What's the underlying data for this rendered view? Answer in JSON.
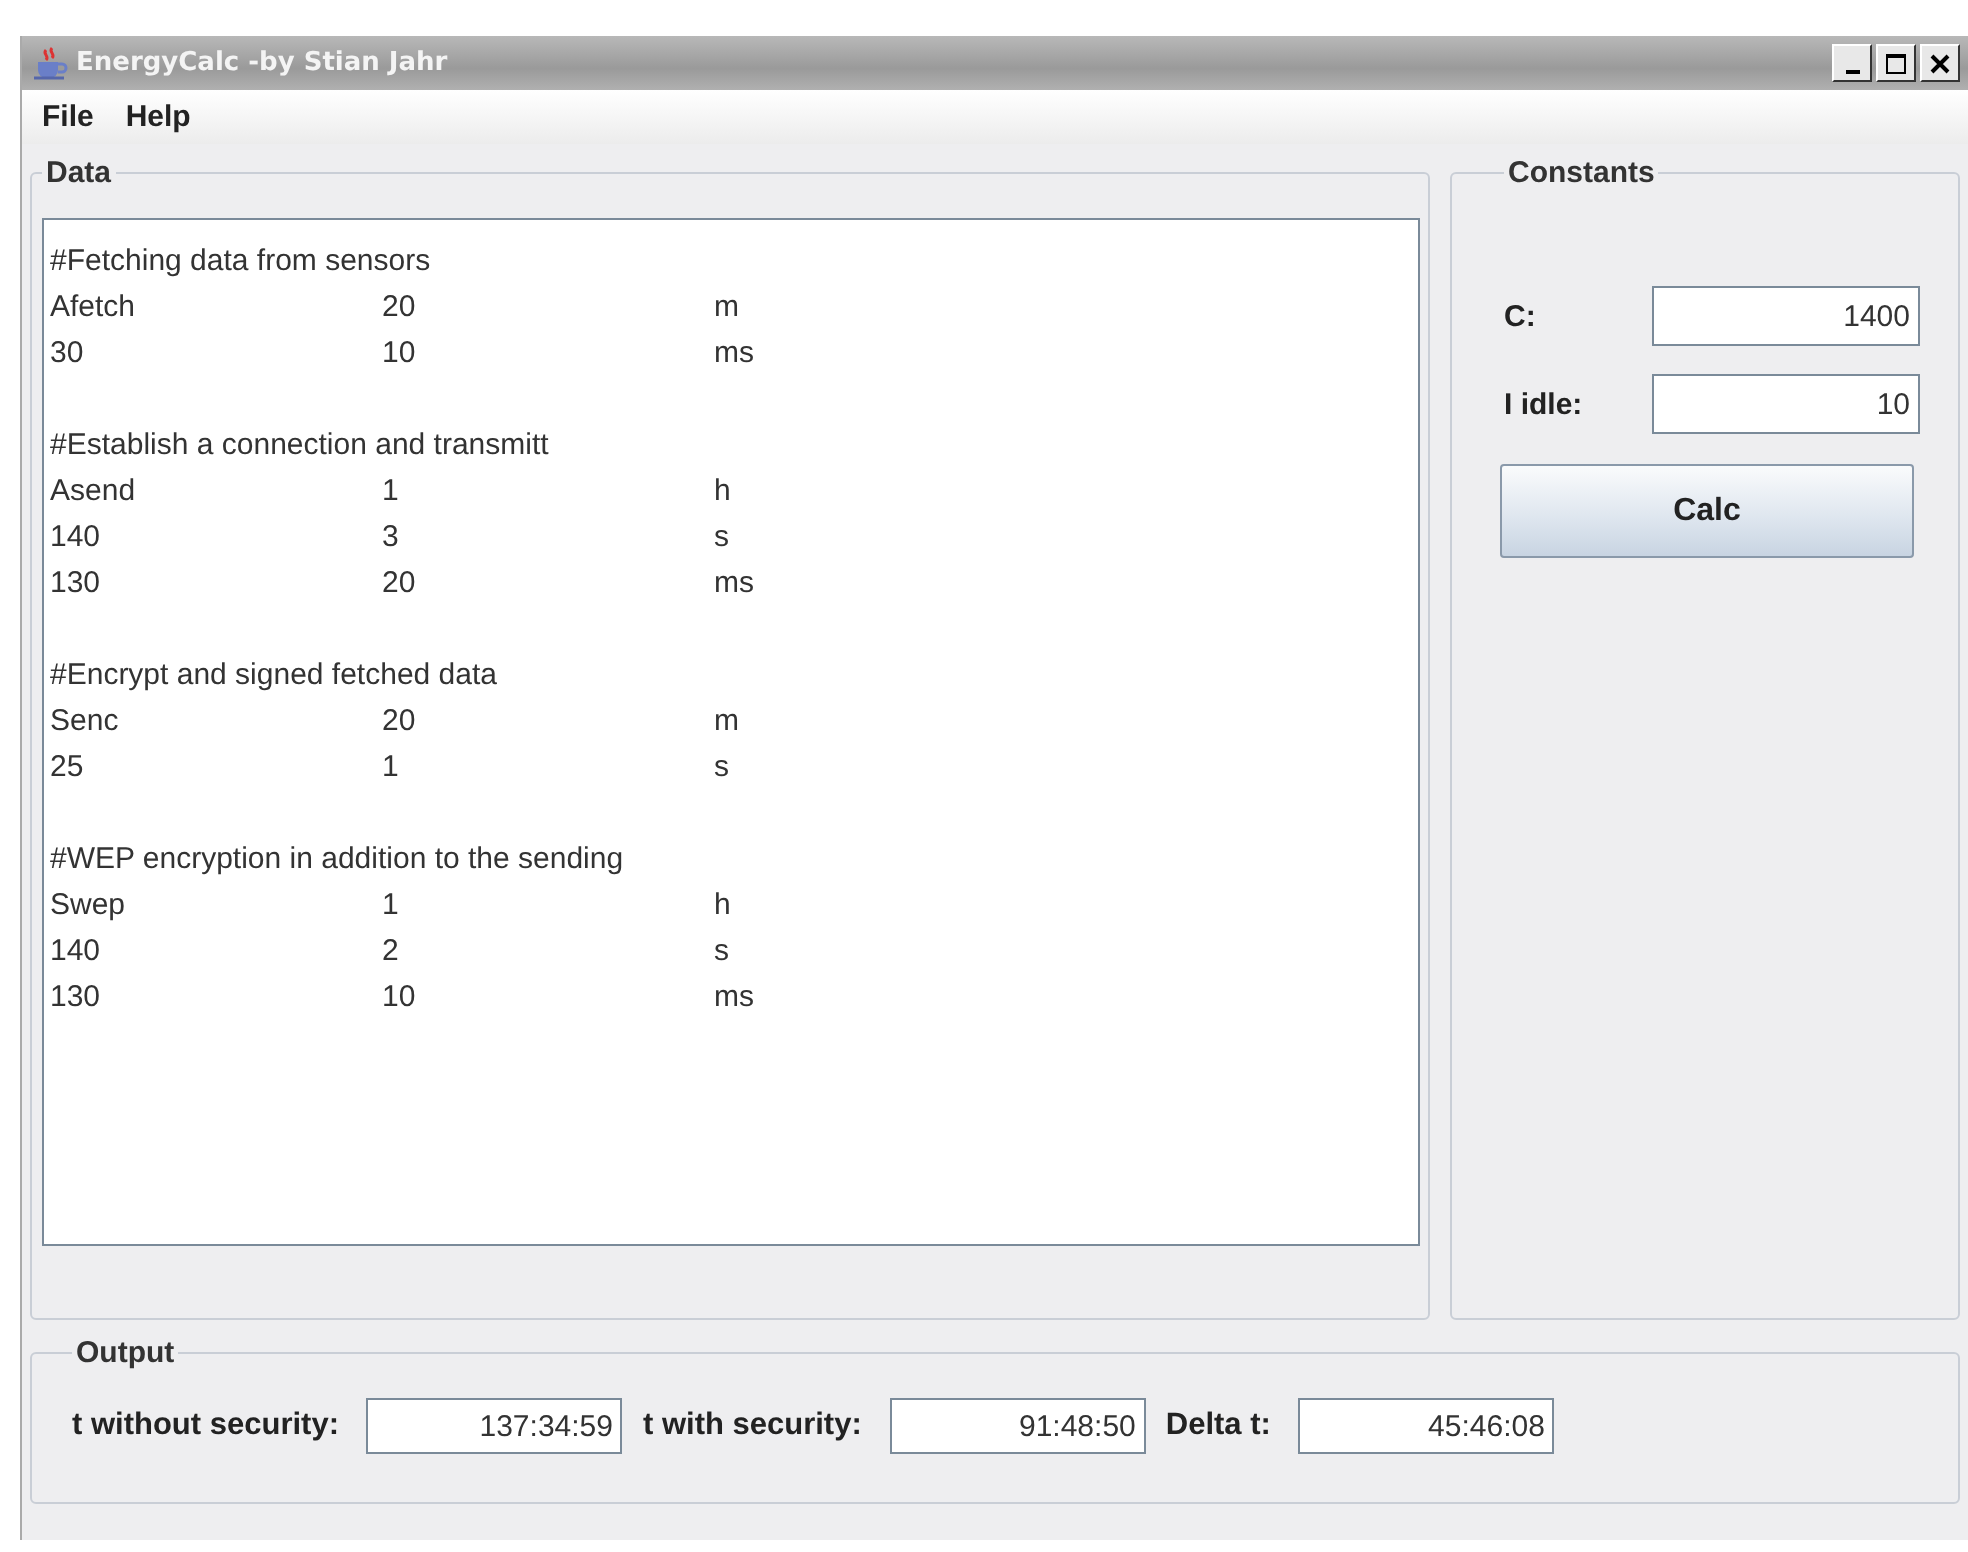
{
  "window": {
    "title": "EnergyCalc  -by Stian Jahr"
  },
  "menu": [
    "File",
    "Help"
  ],
  "data_panel": {
    "title": "Data",
    "lines": [
      {
        "kind": "comment",
        "text": "#Fetching data from sensors"
      },
      {
        "kind": "row",
        "cells": [
          "Afetch",
          "20",
          "m"
        ]
      },
      {
        "kind": "row",
        "cells": [
          "30",
          "10",
          "ms"
        ]
      },
      {
        "kind": "blank"
      },
      {
        "kind": "comment",
        "text": "#Establish a connection and transmitt"
      },
      {
        "kind": "row",
        "cells": [
          "Asend",
          "1",
          "h"
        ]
      },
      {
        "kind": "row",
        "cells": [
          "140",
          "3",
          "s"
        ]
      },
      {
        "kind": "row",
        "cells": [
          "130",
          "20",
          "ms"
        ]
      },
      {
        "kind": "blank"
      },
      {
        "kind": "comment",
        "text": "#Encrypt and signed fetched data"
      },
      {
        "kind": "row",
        "cells": [
          "Senc",
          "20",
          "m"
        ]
      },
      {
        "kind": "row",
        "cells": [
          "25",
          "1",
          "s"
        ]
      },
      {
        "kind": "blank"
      },
      {
        "kind": "comment",
        "text": "#WEP encryption in addition to the sending"
      },
      {
        "kind": "row",
        "cells": [
          "Swep",
          "1",
          "h"
        ]
      },
      {
        "kind": "row",
        "cells": [
          "140",
          "2",
          "s"
        ]
      },
      {
        "kind": "row",
        "cells": [
          "130",
          "10",
          "ms"
        ]
      }
    ]
  },
  "constants_panel": {
    "title": "Constants",
    "fields": [
      {
        "label": "C:",
        "value": "1400"
      },
      {
        "label": "I idle:",
        "value": "10"
      }
    ],
    "button": "Calc"
  },
  "output_panel": {
    "title": "Output",
    "fields": [
      {
        "label": "t without security:",
        "value": "137:34:59"
      },
      {
        "label": "t with security:",
        "value": "91:48:50"
      },
      {
        "label": "Delta t:",
        "value": "45:46:08"
      }
    ]
  }
}
